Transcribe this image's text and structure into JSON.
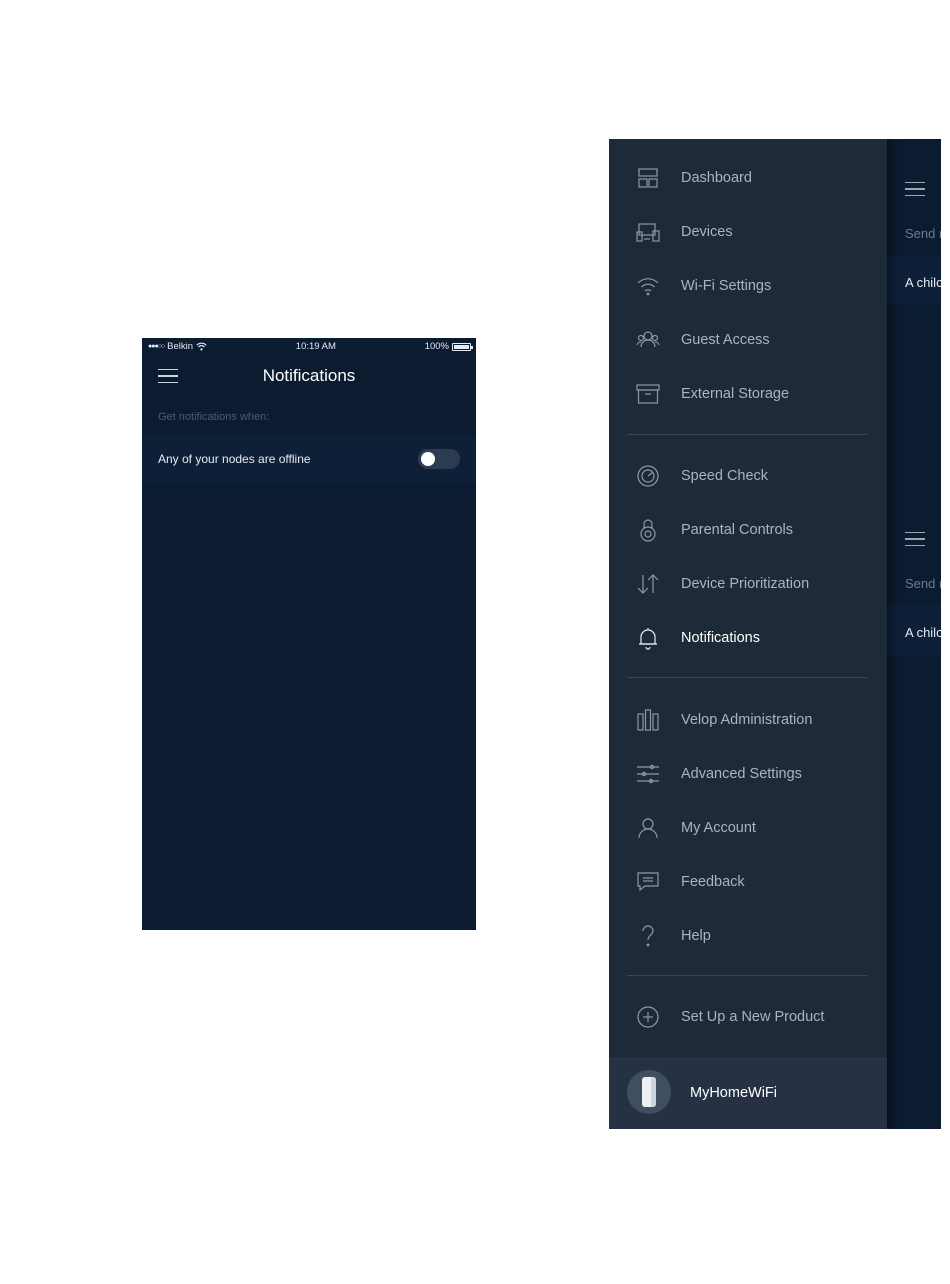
{
  "notifications_screen": {
    "status_bar": {
      "signal": "●●●○○",
      "carrier": "Belkin",
      "time": "10:19 AM",
      "battery": "100%"
    },
    "title": "Notifications",
    "section_label": "Get notifications when:",
    "rows": [
      {
        "label": "Any of your nodes are offline",
        "toggle": "off"
      }
    ]
  },
  "side_menu": {
    "groups": [
      [
        {
          "label": "Dashboard",
          "icon": "dashboard-icon"
        },
        {
          "label": "Devices",
          "icon": "devices-icon"
        },
        {
          "label": "Wi-Fi Settings",
          "icon": "wifi-icon"
        },
        {
          "label": "Guest Access",
          "icon": "guest-access-icon"
        },
        {
          "label": "External Storage",
          "icon": "storage-box-icon"
        }
      ],
      [
        {
          "label": "Speed Check",
          "icon": "speedometer-icon"
        },
        {
          "label": "Parental Controls",
          "icon": "parental-lock-icon"
        },
        {
          "label": "Device Prioritization",
          "icon": "up-down-arrows-icon"
        },
        {
          "label": "Notifications",
          "icon": "bell-icon",
          "active": true
        }
      ],
      [
        {
          "label": "Velop Administration",
          "icon": "velop-nodes-icon"
        },
        {
          "label": "Advanced Settings",
          "icon": "sliders-icon"
        },
        {
          "label": "My Account",
          "icon": "user-icon"
        },
        {
          "label": "Feedback",
          "icon": "chat-bubble-icon"
        },
        {
          "label": "Help",
          "icon": "question-icon"
        }
      ],
      [
        {
          "label": "Set Up a New Product",
          "icon": "plus-circle-icon"
        }
      ]
    ],
    "network_name": "MyHomeWiFi",
    "background_screen": {
      "send_text": "Send r",
      "row_text": "A chilc"
    }
  }
}
